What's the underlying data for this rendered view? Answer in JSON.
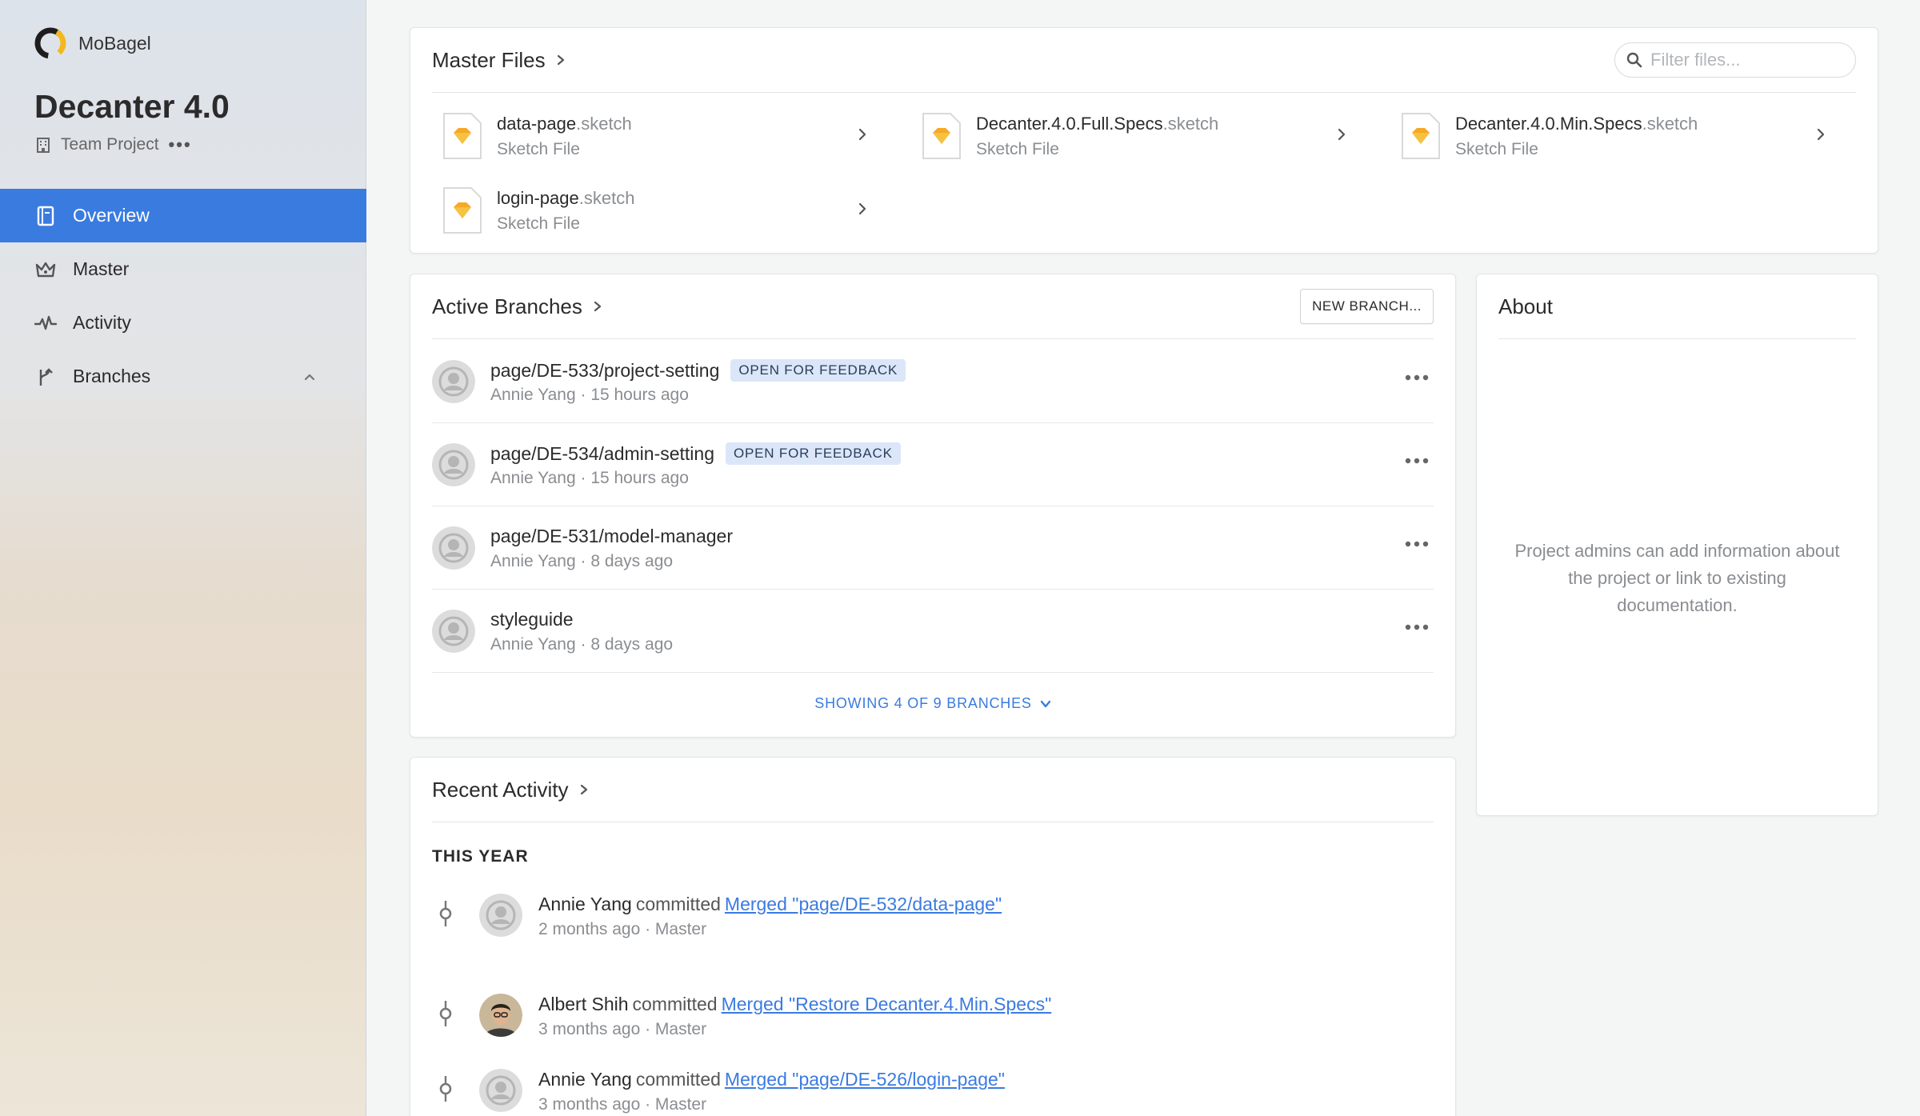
{
  "sidebar": {
    "org_name": "MoBagel",
    "project_title": "Decanter 4.0",
    "project_type": "Team Project",
    "more": "•••",
    "nav": [
      {
        "label": "Overview",
        "icon": "notebook-icon"
      },
      {
        "label": "Master",
        "icon": "crown-icon"
      },
      {
        "label": "Activity",
        "icon": "pulse-icon"
      },
      {
        "label": "Branches",
        "icon": "branch-icon"
      }
    ]
  },
  "master_files": {
    "title": "Master Files",
    "filter_placeholder": "Filter files...",
    "files": [
      {
        "name": "data-page",
        "ext": ".sketch",
        "type": "Sketch File"
      },
      {
        "name": "Decanter.4.0.Full.Specs",
        "ext": ".sketch",
        "type": "Sketch File"
      },
      {
        "name": "Decanter.4.0.Min.Specs",
        "ext": ".sketch",
        "type": "Sketch File"
      },
      {
        "name": "login-page",
        "ext": ".sketch",
        "type": "Sketch File"
      }
    ]
  },
  "active_branches": {
    "title": "Active Branches",
    "new_button": "NEW BRANCH...",
    "branches": [
      {
        "name": "page/DE-533/project-setting",
        "badge": "OPEN FOR FEEDBACK",
        "meta": "Annie Yang · 15 hours ago"
      },
      {
        "name": "page/DE-534/admin-setting",
        "badge": "OPEN FOR FEEDBACK",
        "meta": "Annie Yang · 15 hours ago"
      },
      {
        "name": "page/DE-531/model-manager",
        "badge": "",
        "meta": "Annie Yang · 8 days ago"
      },
      {
        "name": "styleguide",
        "badge": "",
        "meta": "Annie Yang · 8 days ago"
      }
    ],
    "show_more": "SHOWING 4 OF 9 BRANCHES"
  },
  "about": {
    "title": "About",
    "text": "Project admins can add information about the project or link to existing documentation."
  },
  "recent_activity": {
    "title": "Recent Activity",
    "section": "THIS YEAR",
    "items": [
      {
        "user": "Annie Yang",
        "verb": "committed",
        "link": "Merged \"page/DE-532/data-page\"",
        "meta": "2 months ago · Master",
        "avatar": "default"
      },
      {
        "user": "Albert Shih",
        "verb": "committed",
        "link": "Merged \"Restore Decanter.4.Min.Specs\"",
        "meta": "3 months ago · Master",
        "avatar": "photo"
      },
      {
        "user": "Annie Yang",
        "verb": "committed",
        "link": "Merged \"page/DE-526/login-page\"",
        "meta": "3 months ago · Master",
        "avatar": "default"
      }
    ]
  },
  "colors": {
    "accent": "#3a7be0",
    "badge_bg": "#dbe7f9",
    "sketch_orange": "#f7a825"
  }
}
